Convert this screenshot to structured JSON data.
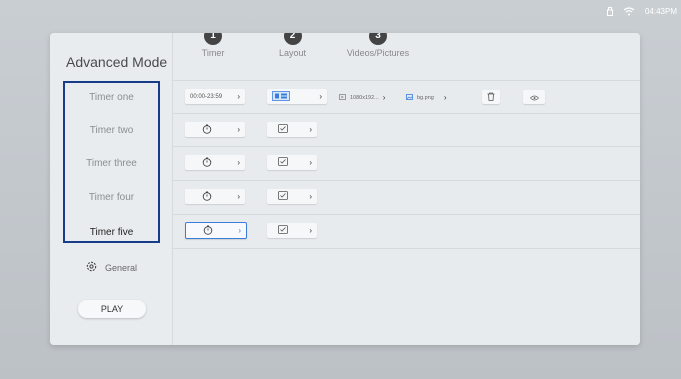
{
  "status": {
    "time": "04:43PM"
  },
  "sidebar": {
    "title": "Advanced Mode",
    "timers": [
      {
        "label": "Timer one"
      },
      {
        "label": "Timer two"
      },
      {
        "label": "Timer three"
      },
      {
        "label": "Timer four"
      },
      {
        "label": "Timer five"
      }
    ],
    "general_label": "General",
    "play_label": "PLAY"
  },
  "columns": [
    {
      "badge": "1",
      "label": "Timer"
    },
    {
      "badge": "2",
      "label": "Layout"
    },
    {
      "badge": "3",
      "label": "Videos/Pictures"
    }
  ],
  "rows": [
    {
      "timer": "00:00-23:59",
      "video": "1080x192...",
      "picture": "bg.png"
    }
  ],
  "colors": {
    "selection": "#163c8a",
    "focus": "#3b7ddd"
  }
}
